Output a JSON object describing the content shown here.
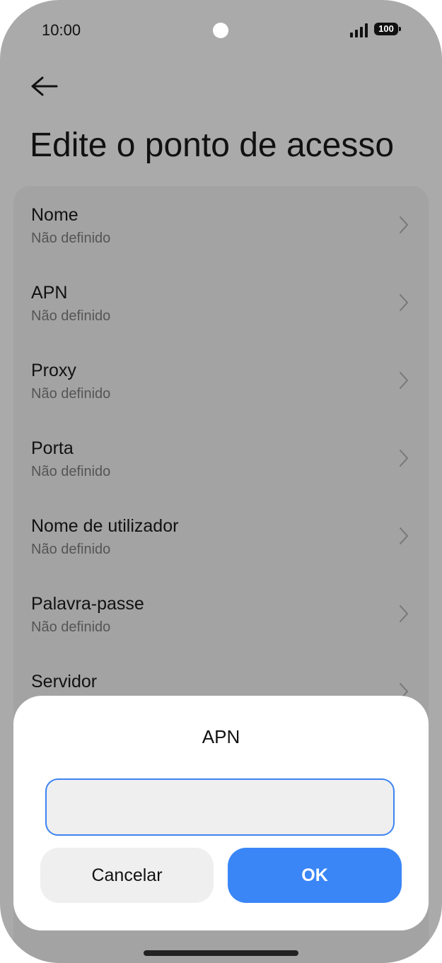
{
  "status_bar": {
    "time": "10:00",
    "battery": "100"
  },
  "header": {
    "title": "Edite o ponto de acesso",
    "back_icon": "arrow-left-icon"
  },
  "settings": {
    "items": [
      {
        "label": "Nome",
        "value": "Não definido"
      },
      {
        "label": "APN",
        "value": "Não definido"
      },
      {
        "label": "Proxy",
        "value": "Não definido"
      },
      {
        "label": "Porta",
        "value": "Não definido"
      },
      {
        "label": "Nome de utilizador",
        "value": "Não definido"
      },
      {
        "label": "Palavra-passe",
        "value": "Não definido"
      },
      {
        "label": "Servidor",
        "value": ""
      }
    ]
  },
  "dialog": {
    "title": "APN",
    "input_value": "",
    "cancel_label": "Cancelar",
    "ok_label": "OK"
  },
  "colors": {
    "dim_background": "#aaaaaa",
    "accent": "#3a86f7",
    "input_border": "#3d84f2"
  }
}
